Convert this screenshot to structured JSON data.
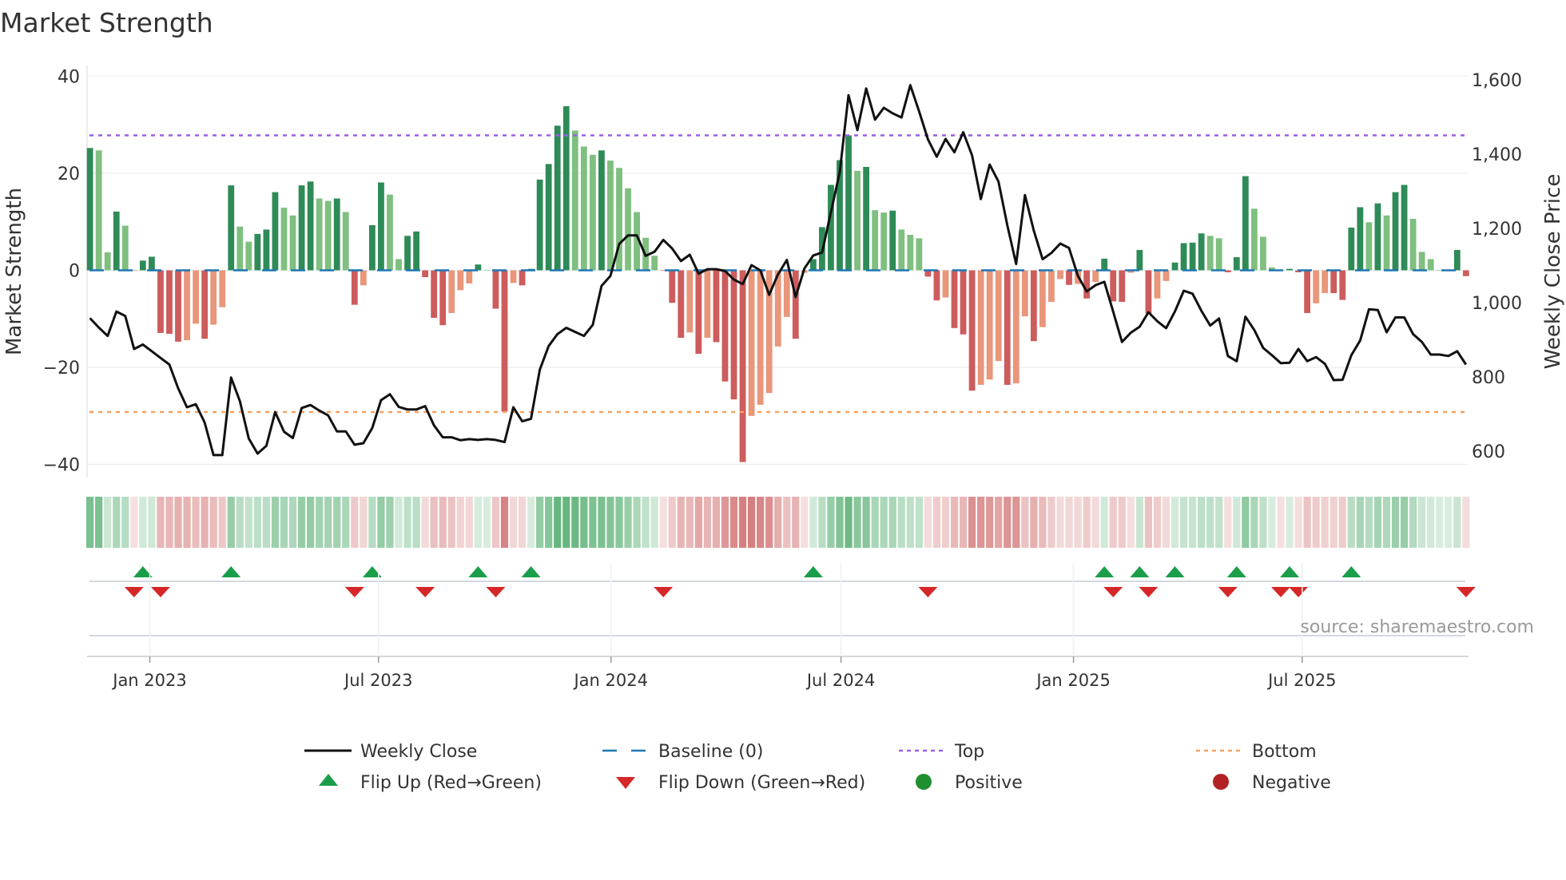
{
  "chart_data": {
    "type": "bar",
    "title": "Market Strength",
    "ylabel": "Market Strength",
    "ylabel_right": "Weekly Close Price",
    "ylim": [
      -42.2,
      42.2
    ],
    "ylim_right": [
      535,
      1639
    ],
    "yticks": [
      40,
      20,
      0,
      -20,
      -40
    ],
    "yticks_labels": [
      "40",
      "20",
      "0",
      "−20",
      "−40"
    ],
    "yticks_right": [
      600,
      800,
      1000,
      1200,
      1400,
      1600
    ],
    "yticks_right_labels": [
      "600",
      "800",
      "1,000",
      "1,200",
      "1,400",
      "1,600"
    ],
    "xticks": [
      {
        "date": "2023-01-01",
        "label": "Jan 2023"
      },
      {
        "date": "2023-07-01",
        "label": "Jul 2023"
      },
      {
        "date": "2024-01-01",
        "label": "Jan 2024"
      },
      {
        "date": "2024-07-01",
        "label": "Jul 2024"
      },
      {
        "date": "2025-01-01",
        "label": "Jan 2025"
      },
      {
        "date": "2025-07-01",
        "label": "Jul 2025"
      }
    ],
    "grid": true,
    "top_level": 27.8,
    "bottom_level": -29.2,
    "baseline": 0,
    "strength": [
      25.2,
      24.7,
      3.7,
      12.1,
      9.2,
      -0.1,
      2.0,
      2.8,
      -12.9,
      -13.1,
      -14.7,
      -14.4,
      -11.0,
      -14.1,
      -11.2,
      -7.6,
      17.5,
      9.0,
      5.9,
      7.5,
      8.4,
      16.1,
      12.9,
      11.3,
      17.5,
      18.3,
      14.8,
      14.3,
      14.8,
      12.0,
      -7.1,
      -3.1,
      9.3,
      18.1,
      15.6,
      2.3,
      7.1,
      8.0,
      -1.4,
      -9.8,
      -11.3,
      -8.8,
      -4.1,
      -2.7,
      1.2,
      0.1,
      -7.9,
      -29.1,
      -2.6,
      -3.1,
      0.3,
      18.7,
      21.9,
      29.8,
      33.8,
      28.8,
      25.5,
      23.8,
      24.7,
      22.6,
      21.1,
      16.9,
      12.0,
      6.7,
      3.0,
      -0.1,
      -6.7,
      -13.9,
      -12.8,
      -17.2,
      -13.9,
      -14.8,
      -22.9,
      -26.6,
      -39.5,
      -30.0,
      -27.7,
      -25.3,
      -15.7,
      -9.6,
      -14.1,
      -0.5,
      2.3,
      8.9,
      17.6,
      22.7,
      27.8,
      20.5,
      21.3,
      12.4,
      11.9,
      12.3,
      8.4,
      7.3,
      6.6,
      -1.3,
      -6.2,
      -5.6,
      -11.9,
      -13.2,
      -24.8,
      -23.6,
      -22.5,
      -18.7,
      -23.6,
      -23.3,
      -9.5,
      -14.6,
      -11.7,
      -6.5,
      -1.8,
      -3.0,
      -2.8,
      -5.8,
      -2.4,
      2.4,
      -6.4,
      -6.5,
      -0.5,
      4.2,
      -8.9,
      -5.8,
      -2.2,
      1.6,
      5.6,
      5.7,
      7.6,
      7.1,
      6.6,
      -0.4,
      2.7,
      19.4,
      12.7,
      6.9,
      0.6,
      -0.1,
      0.3,
      -0.4,
      -8.8,
      -6.8,
      -4.7,
      -4.7,
      -6.1,
      8.8,
      13.0,
      9.9,
      13.8,
      11.3,
      16.1,
      17.6,
      10.6,
      3.8,
      2.3,
      0.0,
      0.0,
      4.2,
      -1.2
    ],
    "close": [
      958,
      933,
      910,
      976,
      964,
      875,
      887,
      869,
      851,
      833,
      769,
      718,
      726,
      677,
      589,
      589,
      798,
      734,
      634,
      593,
      614,
      705,
      652,
      635,
      716,
      724,
      709,
      696,
      653,
      653,
      617,
      621,
      662,
      737,
      753,
      719,
      712,
      712,
      721,
      669,
      637,
      637,
      629,
      632,
      630,
      632,
      630,
      624,
      718,
      680,
      687,
      819,
      883,
      915,
      932,
      921,
      910,
      940,
      1045,
      1072,
      1158,
      1181,
      1181,
      1126,
      1137,
      1169,
      1146,
      1112,
      1129,
      1078,
      1090,
      1090,
      1085,
      1062,
      1050,
      1101,
      1087,
      1021,
      1076,
      1115,
      1015,
      1092,
      1127,
      1135,
      1244,
      1351,
      1559,
      1465,
      1577,
      1493,
      1525,
      1510,
      1499,
      1586,
      1515,
      1440,
      1393,
      1441,
      1405,
      1459,
      1397,
      1279,
      1372,
      1326,
      1208,
      1104,
      1290,
      1194,
      1117,
      1134,
      1159,
      1147,
      1072,
      1030,
      1047,
      1056,
      976,
      894,
      919,
      935,
      974,
      950,
      931,
      976,
      1032,
      1024,
      978,
      938,
      957,
      856,
      842,
      962,
      926,
      878,
      858,
      837,
      838,
      875,
      842,
      853,
      835,
      791,
      792,
      858,
      898,
      982,
      980,
      920,
      960,
      960,
      915,
      894,
      860,
      860,
      856,
      869,
      833
    ],
    "flip_up_weeks": [
      7,
      17,
      33,
      45,
      51,
      83,
      116,
      120,
      124,
      131,
      137,
      144
    ],
    "flip_down_weeks": [
      6,
      9,
      31,
      39,
      47,
      66,
      96,
      117,
      121,
      130,
      136,
      138,
      157
    ],
    "legend": [
      {
        "label": "Weekly Close",
        "kind": "line"
      },
      {
        "label": "Baseline (0)",
        "kind": "dash"
      },
      {
        "label": "Top",
        "kind": "dot-purple"
      },
      {
        "label": "Bottom",
        "kind": "dot-orange"
      },
      {
        "label": "Flip Up (Red→Green)",
        "kind": "tri-up"
      },
      {
        "label": "Flip Down (Green→Red)",
        "kind": "tri-down"
      },
      {
        "label": "Positive",
        "kind": "dot-green"
      },
      {
        "label": "Negative",
        "kind": "dot-red"
      }
    ],
    "legend_position": "bottom",
    "source": "source: sharemaestro.com",
    "colors": {
      "up_strong": "#2e8b57",
      "up_weak": "#7fbf7f",
      "down_strong": "#cd5c5c",
      "down_weak": "#e9967a",
      "close": "#111111",
      "baseline": "#1f77b4",
      "top": "#9b5de5",
      "bottom": "#f4a261",
      "flip_up": "#1a9e4a",
      "flip_down": "#d62728",
      "positive": "#1f8f2f",
      "negative": "#b22222"
    }
  }
}
